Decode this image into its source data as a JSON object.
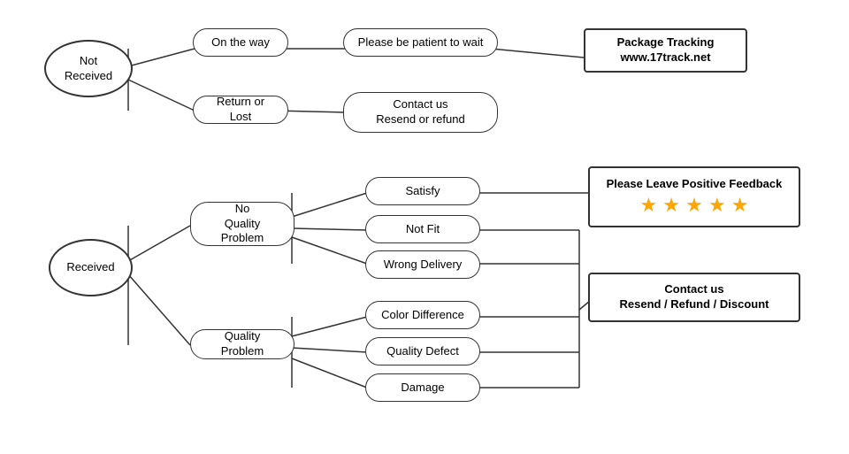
{
  "nodes": {
    "not_received": {
      "label": "Not\nReceived"
    },
    "received": {
      "label": "Received"
    },
    "on_the_way": {
      "label": "On the way"
    },
    "return_or_lost": {
      "label": "Return or Lost"
    },
    "patient_wait": {
      "label": "Please be patient to wait"
    },
    "contact_resend_refund": {
      "label": "Contact us\nResend or refund"
    },
    "package_tracking": {
      "label": "Package Tracking\nwww.17track.net"
    },
    "no_quality_problem": {
      "label": "No\nQuality Problem"
    },
    "quality_problem": {
      "label": "Quality Problem"
    },
    "satisfy": {
      "label": "Satisfy"
    },
    "not_fit": {
      "label": "Not Fit"
    },
    "wrong_delivery": {
      "label": "Wrong Delivery"
    },
    "color_difference": {
      "label": "Color Difference"
    },
    "quality_defect": {
      "label": "Quality Defect"
    },
    "damage": {
      "label": "Damage"
    },
    "please_feedback": {
      "label": "Please Leave Positive Feedback"
    },
    "stars": {
      "label": "★ ★ ★ ★ ★"
    },
    "contact_resend_refund_discount": {
      "label": "Contact us\nResend / Refund / Discount"
    }
  }
}
